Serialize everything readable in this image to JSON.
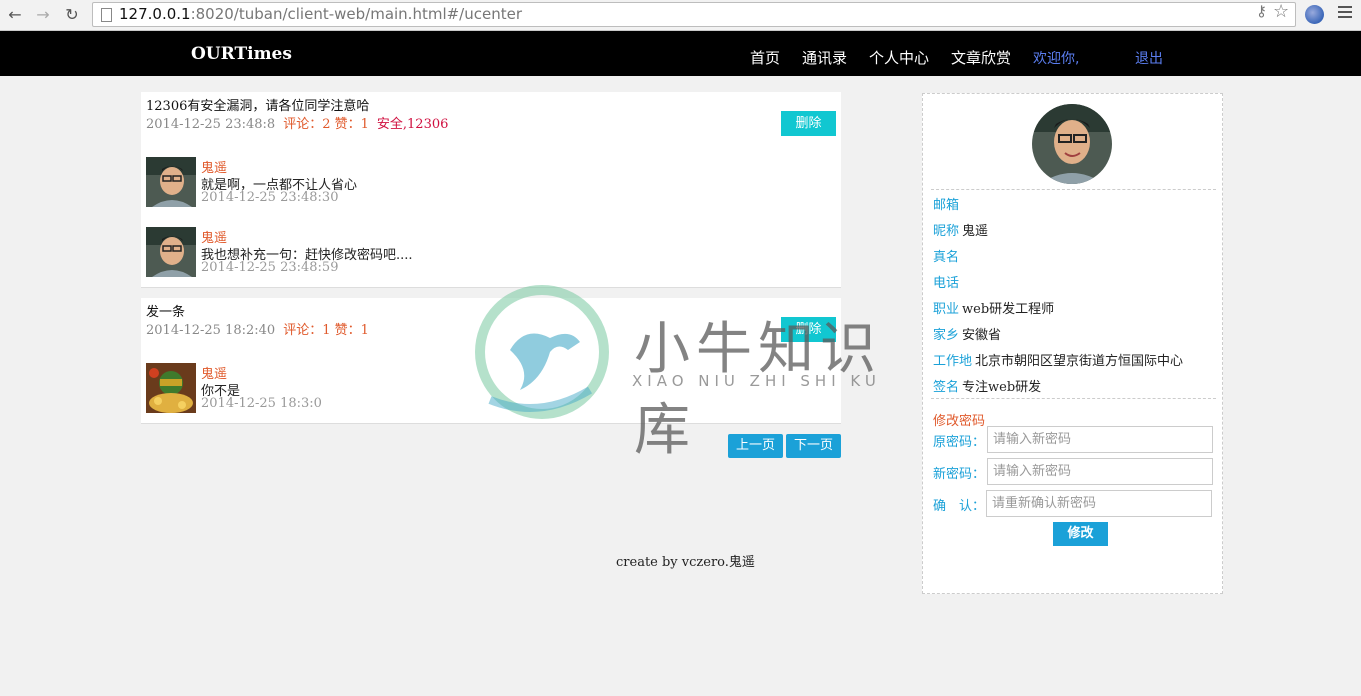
{
  "browser": {
    "url_host": "127.0.0.1",
    "url_path": ":8020/tuban/client-web/main.html#/ucenter"
  },
  "navbar": {
    "brand": "OURTimes",
    "links": [
      "首页",
      "通讯录",
      "个人中心",
      "文章欣赏"
    ],
    "welcome": "欢迎你,",
    "logout": "退出"
  },
  "posts": [
    {
      "title": "12306有安全漏洞，请各位同学注意哈",
      "time": "2014-12-25 23:48:8",
      "stats": "评论：2 赞：1",
      "tags": "安全,12306",
      "delete_label": "删除",
      "comments": [
        {
          "user": "鬼遥",
          "text": "就是啊，一点都不让人省心",
          "time": "2014-12-25 23:48:30"
        },
        {
          "user": "鬼遥",
          "text": "我也想补充一句：赶快修改密码吧....",
          "time": "2014-12-25 23:48:59"
        }
      ]
    },
    {
      "title": "发一条",
      "time": "2014-12-25 18:2:40",
      "stats": "评论：1 赞：1",
      "tags": "",
      "delete_label": "删除",
      "comments": [
        {
          "user": "鬼遥",
          "text": "你不是",
          "time": "2014-12-25 18:3:0"
        }
      ]
    }
  ],
  "pager": {
    "prev": "上一页",
    "next": "下一页"
  },
  "footer": "create by vczero.鬼遥",
  "profile": {
    "fields": [
      {
        "key": "邮箱",
        "value": ""
      },
      {
        "key": "昵称",
        "value": "鬼遥"
      },
      {
        "key": "真名",
        "value": ""
      },
      {
        "key": "电话",
        "value": ""
      },
      {
        "key": "职业",
        "value": "web研发工程师"
      },
      {
        "key": "家乡",
        "value": "安徽省"
      },
      {
        "key": "工作地",
        "value": "北京市朝阳区望京街道方恒国际中心"
      },
      {
        "key": "签名",
        "value": "专注web研发"
      }
    ],
    "password": {
      "title": "修改密码",
      "old_label": "原密码：",
      "old_placeholder": "请输入新密码",
      "new_label": "新密码：",
      "new_placeholder": "请输入新密码",
      "confirm_label": "确　认：",
      "confirm_placeholder": "请重新确认新密码",
      "submit": "修改"
    }
  },
  "watermark": {
    "title": "小牛知识库",
    "subtitle": "XIAO NIU ZHI SHI KU"
  },
  "colors": {
    "accent": "#1ba1d8",
    "delete": "#11c7d1",
    "username": "#e05a2c",
    "navbar": "#000000"
  }
}
